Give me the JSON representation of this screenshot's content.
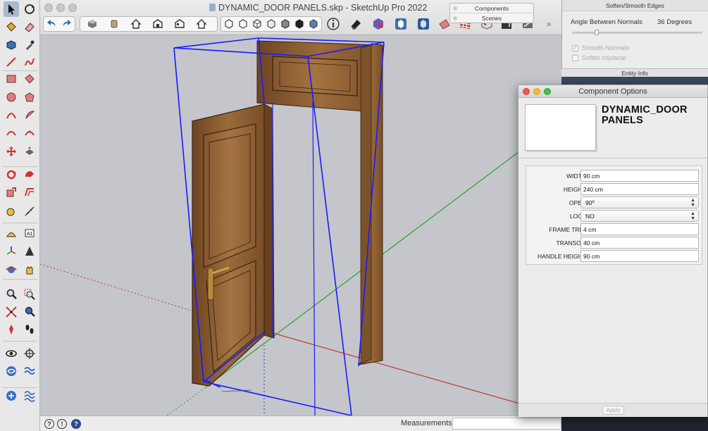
{
  "window": {
    "title": "DYNAMIC_DOOR PANELS.skp - SketchUp Pro 2022"
  },
  "mini_panel": {
    "components_label": "Components",
    "scenes_label": "Scenes"
  },
  "soften_panel": {
    "title": "Soften/Smooth Edges",
    "angle_label": "Angle Between Normals",
    "angle_value": "36  Degrees",
    "smooth_normals_label": "Smooth Normals",
    "smooth_normals_checked": true,
    "soften_coplanar_label": "Soften coplanar",
    "soften_coplanar_checked": false
  },
  "entity_info": {
    "title": "Entity Info"
  },
  "component_options": {
    "title": "Component Options",
    "component_name": "DYNAMIC_DOOR PANELS",
    "fields": [
      {
        "label": "WIDTH",
        "value": "90 cm",
        "type": "input"
      },
      {
        "label": "HEIGHT",
        "value": "240 cm",
        "type": "input"
      },
      {
        "label": "OPEN",
        "value": "90º",
        "type": "select"
      },
      {
        "label": "LOCK",
        "value": "NO",
        "type": "select"
      },
      {
        "label": "FRAME TRIM",
        "value": "4 cm",
        "type": "input"
      },
      {
        "label": "TRANSOM",
        "value": "40 cm",
        "type": "input"
      },
      {
        "label": "HANDLE HEIGHT",
        "value": "90 cm",
        "type": "input"
      }
    ],
    "apply_label": "Apply"
  },
  "statusbar": {
    "measurements_label": "Measurements",
    "measurements_value": ""
  },
  "colors": {
    "viewport_bg": "#c4c6cb",
    "selection_blue": "#1a1aff",
    "wood": "#8a5f33",
    "axis_green": "#2f9e2f",
    "axis_red": "#c0392b"
  },
  "icons": {
    "left_palette": [
      "select-icon",
      "orbit-arrow-icon",
      "paint-bucket-icon",
      "eraser-icon",
      "make-component-icon",
      "eyedropper-icon",
      "line-icon",
      "freehand-icon",
      "rectangle-icon",
      "rotated-rectangle-icon",
      "circle-icon",
      "polygon-icon",
      "arc-icon",
      "pie-icon",
      "two-point-arc-icon",
      "three-point-arc-icon",
      "move-icon",
      "push-pull-icon",
      "rotate-icon",
      "follow-me-icon",
      "scale-icon",
      "offset-icon",
      "tape-measure-icon",
      "dimension-icon",
      "protractor-icon",
      "text-icon",
      "axes-icon",
      "3d-text-icon",
      "orbit-icon",
      "pan-icon",
      "zoom-icon",
      "zoom-window-icon",
      "zoom-extents-icon",
      "previous-view-icon",
      "position-camera-icon",
      "walk-icon",
      "look-around-icon",
      "section-plane-icon",
      "sandbox-icon",
      "sandbox-smoove-icon",
      "sandbox-stamp-icon",
      "sandbox-drape-icon"
    ]
  }
}
